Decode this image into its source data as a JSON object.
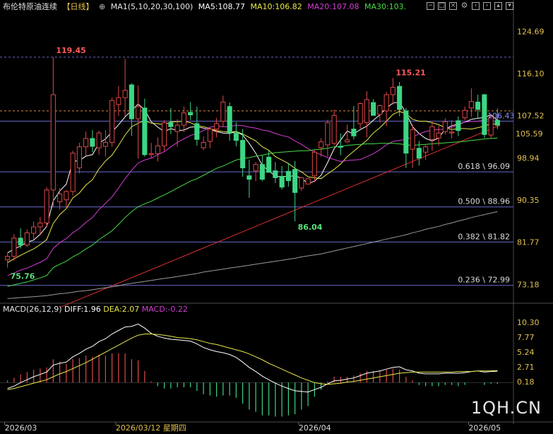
{
  "header": {
    "instrument": "布伦特原油连续",
    "period": "【日线】",
    "ma_params": "MA1(5,10,20,30,100)",
    "ma5": "MA5:108.77",
    "ma10": "MA10:106.82",
    "ma20": "MA20:107.08",
    "ma30": "MA30:103."
  },
  "macd_header": {
    "params": "MACD(26,12,9)",
    "diff": "DIFF:1.96",
    "dea": "DEA:2.07",
    "macd": "MACD:-0.22"
  },
  "watermark": "1QH.CN",
  "colors": {
    "background": "#000000",
    "up_candle": "#e04848",
    "down_candle": "#3cd684",
    "ma5": "#ffffff",
    "ma10": "#e8e84a",
    "ma20": "#d43fd4",
    "ma30": "#44dd44",
    "ma100": "#9a9a9a",
    "trendline": "#e03030",
    "fib_line": "#6a6acd",
    "last_price_line": "#e08a3a",
    "high_line": "#6a6acd",
    "price_label": "#e8c14a"
  },
  "icons": [
    "minimize-icon",
    "expand-icon",
    "close-icon",
    "gear-icon",
    "left-arrow-icon",
    "right-arrow-icon",
    "up-icon",
    "down-icon",
    "compare-icon"
  ],
  "chart_data": {
    "type": "candlestick",
    "title": "布伦特原油连续 【日线】",
    "price_axis": {
      "ticks": [
        124.69,
        116.1,
        107.52,
        98.94,
        90.35,
        81.77,
        73.18
      ],
      "ylim": [
        69.5,
        128.2
      ]
    },
    "macd_axis": {
      "ticks": [
        10.3,
        7.77,
        5.24,
        2.71,
        0.18
      ],
      "ylim": [
        -6.6,
        11.5
      ]
    },
    "x_labels": [
      "2026/03",
      "2026/03/12 星期四",
      "2026/04",
      "2026/05"
    ],
    "annotations": {
      "high_left": "119.45",
      "high_right": "115.21",
      "low_left": "75.76",
      "low_mid": "86.04"
    },
    "price_tags": {
      "current": "106.43",
      "close": "105.59"
    },
    "fibonacci": [
      {
        "label": "0.618 \\ 96.09",
        "value": 96.09
      },
      {
        "label": "0.500 \\ 88.96",
        "value": 88.96
      },
      {
        "label": "0.382 \\ 81.82",
        "value": 81.82
      },
      {
        "label": "0.236 \\ 72.99",
        "value": 72.99
      }
    ],
    "reference_lines": {
      "upper": 119.45,
      "last": 108.5,
      "mid": 106.43
    },
    "candles": [
      [
        78.2,
        79.5,
        76.6,
        78.9
      ],
      [
        78.9,
        83.4,
        78.0,
        82.6
      ],
      [
        82.6,
        84.6,
        80.5,
        81.2
      ],
      [
        81.2,
        84.4,
        80.8,
        83.7
      ],
      [
        83.6,
        86.0,
        82.4,
        84.9
      ],
      [
        84.9,
        86.9,
        83.1,
        85.7
      ],
      [
        85.7,
        93.0,
        85.0,
        92.4
      ],
      [
        92.4,
        119.45,
        88.9,
        111.8
      ],
      [
        90.0,
        92.8,
        88.4,
        91.6
      ],
      [
        90.4,
        92.4,
        88.8,
        92.1
      ],
      [
        92.1,
        100.4,
        91.3,
        99.9
      ],
      [
        96.9,
        102.0,
        95.8,
        101.2
      ],
      [
        101.2,
        104.3,
        99.3,
        102.9
      ],
      [
        102.9,
        104.6,
        100.1,
        101.3
      ],
      [
        101.0,
        104.5,
        99.6,
        104.0
      ],
      [
        101.3,
        104.6,
        99.2,
        102.1
      ],
      [
        102.1,
        111.2,
        101.2,
        110.6
      ],
      [
        109.8,
        113.6,
        107.5,
        111.2
      ],
      [
        111.2,
        119.1,
        107.4,
        112.7
      ],
      [
        113.8,
        114.1,
        103.4,
        106.9
      ],
      [
        106.9,
        113.7,
        98.8,
        109.4
      ],
      [
        109.1,
        111.0,
        99.2,
        99.6
      ],
      [
        99.6,
        102.0,
        98.8,
        99.8
      ],
      [
        99.8,
        103.1,
        98.2,
        101.4
      ],
      [
        101.4,
        106.6,
        100.3,
        106.1
      ],
      [
        106.1,
        109.1,
        103.8,
        105.3
      ],
      [
        104.3,
        106.8,
        101.2,
        105.6
      ],
      [
        105.6,
        109.4,
        104.2,
        108.1
      ],
      [
        108.2,
        110.3,
        106.7,
        107.7
      ],
      [
        105.9,
        109.4,
        101.4,
        102.7
      ],
      [
        101.0,
        103.3,
        100.5,
        102.1
      ],
      [
        102.3,
        105.0,
        100.9,
        104.8
      ],
      [
        104.8,
        107.1,
        103.1,
        105.9
      ],
      [
        106.4,
        111.6,
        105.2,
        110.3
      ],
      [
        109.4,
        110.2,
        102.4,
        104.0
      ],
      [
        104.0,
        106.2,
        101.3,
        102.5
      ],
      [
        102.5,
        104.8,
        95.1,
        96.9
      ],
      [
        95.3,
        98.6,
        90.8,
        94.6
      ],
      [
        96.3,
        98.1,
        94.2,
        97.6
      ],
      [
        97.6,
        99.5,
        94.2,
        94.6
      ],
      [
        99.1,
        100.5,
        98.0,
        96.0
      ],
      [
        96.3,
        98.1,
        93.8,
        94.9
      ],
      [
        95.2,
        97.3,
        92.5,
        93.0
      ],
      [
        96.2,
        97.9,
        93.1,
        94.3
      ],
      [
        96.6,
        98.3,
        86.04,
        91.9
      ],
      [
        92.8,
        95.0,
        92.2,
        94.9
      ],
      [
        93.6,
        94.8,
        93.6,
        94.7
      ],
      [
        95.3,
        100.6,
        94.0,
        100.1
      ],
      [
        101.0,
        102.9,
        99.2,
        102.2
      ],
      [
        101.6,
        106.7,
        99.2,
        106.1
      ],
      [
        101.9,
        108.8,
        101.5,
        107.6
      ],
      [
        101.3,
        103.9,
        99.5,
        101.1
      ],
      [
        102.2,
        105.7,
        102.0,
        102.6
      ],
      [
        104.8,
        109.5,
        102.7,
        103.4
      ],
      [
        105.9,
        110.2,
        104.9,
        110.0
      ],
      [
        106.1,
        112.5,
        103.1,
        110.8
      ],
      [
        110.2,
        110.9,
        108.1,
        107.6
      ],
      [
        107.8,
        109.8,
        106.1,
        109.6
      ],
      [
        108.5,
        112.4,
        105.4,
        111.8
      ],
      [
        111.8,
        115.21,
        109.8,
        113.3
      ],
      [
        113.5,
        114.4,
        107.4,
        108.8
      ],
      [
        108.5,
        109.1,
        96.9,
        99.9
      ],
      [
        100.7,
        105.7,
        96.9,
        104.7
      ],
      [
        100.9,
        102.4,
        97.4,
        98.9
      ],
      [
        100.1,
        101.7,
        98.5,
        101.2
      ],
      [
        102.7,
        106.4,
        100.4,
        105.3
      ],
      [
        103.0,
        105.5,
        101.4,
        104.0
      ],
      [
        104.3,
        107.0,
        103.7,
        106.3
      ],
      [
        104.0,
        106.6,
        102.9,
        104.2
      ],
      [
        106.5,
        107.4,
        103.4,
        104.5
      ],
      [
        107.1,
        109.4,
        106.6,
        108.6
      ],
      [
        109.1,
        113.1,
        107.3,
        110.4
      ],
      [
        110.3,
        111.8,
        107.0,
        108.8
      ],
      [
        111.8,
        112.0,
        103.0,
        103.7
      ],
      [
        103.6,
        107.6,
        103.0,
        107.3
      ],
      [
        106.6,
        109.0,
        104.8,
        105.6
      ]
    ],
    "series": [
      {
        "name": "MA5",
        "values": [
          79.6,
          80.4,
          81.0,
          81.8,
          82.2,
          83.4,
          85.0,
          90.2,
          92.2,
          93.6,
          98.2,
          98.4,
          99.3,
          99.6,
          101.9,
          102.8,
          104.2,
          105.7,
          107.3,
          108.6,
          109.9,
          108.7,
          106.3,
          105.2,
          104.3,
          104.9,
          104.5,
          104.6,
          105.2,
          105.3,
          105.0,
          104.7,
          104.3,
          104.0,
          103.9,
          104.3,
          103.6,
          101.9,
          99.9,
          97.4,
          96.3,
          95.2,
          95.1,
          95.2,
          95.3,
          94.8,
          93.7,
          94.2,
          95.4,
          98.0,
          100.8,
          102.6,
          104.4,
          103.8,
          104.7,
          105.4,
          106.6,
          107.7,
          109.1,
          110.1,
          110.3,
          108.1,
          105.3,
          103.9,
          102.9,
          102.4,
          103.0,
          104.8,
          105.5,
          105.8,
          106.2,
          106.8,
          107.0,
          107.2,
          107.7,
          106.6
        ]
      },
      {
        "name": "MA10",
        "values": [
          77.6,
          78.4,
          79.1,
          79.8,
          80.4,
          81.3,
          82.3,
          85.6,
          87.4,
          88.6,
          90.8,
          91.8,
          93.4,
          94.5,
          96.7,
          98.3,
          99.5,
          101.5,
          103.6,
          105.3,
          106.0,
          106.5,
          106.0,
          105.9,
          105.7,
          106.3,
          106.3,
          106.4,
          106.1,
          105.5,
          105.3,
          104.9,
          104.5,
          104.3,
          104.2,
          104.3,
          103.8,
          103.1,
          102.4,
          101.2,
          100.5,
          99.2,
          98.5,
          97.8,
          96.8,
          96.1,
          95.1,
          94.9,
          94.7,
          95.7,
          96.6,
          97.7,
          99.2,
          100.3,
          101.4,
          102.5,
          104.0,
          105.1,
          106.4,
          107.8,
          108.4,
          107.9,
          106.8,
          106.4,
          106.4,
          106.1,
          105.7,
          105.1,
          104.7,
          104.9,
          104.9,
          104.8,
          105.1,
          105.4,
          105.9,
          105.8
        ]
      },
      {
        "name": "MA20",
        "values": [
          75.0,
          75.5,
          76.1,
          76.5,
          77.1,
          77.7,
          78.4,
          80.5,
          81.7,
          82.5,
          83.7,
          84.6,
          85.8,
          86.8,
          88.4,
          89.7,
          91.0,
          92.8,
          94.7,
          96.4,
          97.9,
          98.5,
          98.9,
          99.6,
          100.2,
          101.2,
          102.1,
          102.8,
          103.5,
          103.9,
          104.5,
          105.2,
          105.4,
          105.3,
          105.3,
          105.6,
          105.5,
          105.2,
          105.0,
          104.6,
          104.4,
          103.9,
          103.5,
          103.2,
          102.4,
          101.7,
          100.8,
          100.1,
          99.6,
          99.0,
          98.6,
          98.2,
          98.4,
          98.5,
          98.6,
          99.2,
          99.8,
          100.6,
          101.6,
          102.3,
          102.5,
          102.7,
          103.2,
          103.8,
          104.3,
          104.6,
          104.7,
          104.8,
          105.2,
          105.7,
          106.2,
          106.4,
          106.4,
          106.6,
          107.0,
          107.1
        ]
      },
      {
        "name": "MA30",
        "values": [
          72.8,
          73.1,
          73.4,
          73.7,
          74.1,
          74.5,
          75.0,
          76.6,
          77.3,
          77.9,
          78.8,
          79.5,
          80.4,
          81.2,
          82.3,
          83.2,
          84.1,
          85.4,
          86.8,
          88.0,
          89.0,
          89.6,
          90.1,
          90.8,
          91.4,
          92.1,
          92.8,
          93.5,
          94.2,
          94.7,
          95.4,
          96.1,
          96.8,
          97.3,
          97.9,
          98.5,
          98.8,
          99.0,
          99.3,
          99.5,
          99.8,
          100.0,
          100.1,
          100.2,
          100.3,
          100.4,
          100.4,
          100.6,
          100.7,
          100.9,
          101.2,
          101.3,
          101.5,
          101.6,
          101.7,
          101.8,
          101.8,
          101.9,
          101.9,
          101.9,
          101.8,
          101.6,
          101.5,
          101.6,
          101.7,
          101.8,
          101.9,
          102.0,
          102.1,
          102.2,
          102.3,
          102.5,
          102.6,
          102.8,
          102.9,
          103.0
        ]
      },
      {
        "name": "MA100",
        "values": [
          70.3,
          70.4,
          70.5,
          70.6,
          70.7,
          70.8,
          70.9,
          71.1,
          71.3,
          71.4,
          71.6,
          71.8,
          71.9,
          72.1,
          72.3,
          72.5,
          72.7,
          72.9,
          73.2,
          73.4,
          73.6,
          73.8,
          74.0,
          74.2,
          74.4,
          74.6,
          74.8,
          75.0,
          75.2,
          75.4,
          75.7,
          75.9,
          76.1,
          76.3,
          76.5,
          76.7,
          76.9,
          77.1,
          77.3,
          77.5,
          77.7,
          77.9,
          78.1,
          78.3,
          78.5,
          78.8,
          79.0,
          79.2,
          79.4,
          79.7,
          80.0,
          80.3,
          80.6,
          80.9,
          81.2,
          81.5,
          81.8,
          82.1,
          82.4,
          82.7,
          83.0,
          83.3,
          83.7,
          84.0,
          84.4,
          84.7,
          85.0,
          85.4,
          85.7,
          86.1,
          86.4,
          86.8,
          87.1,
          87.4,
          87.7,
          88.0
        ]
      }
    ],
    "macd_series": {
      "diff": [
        -1.0,
        -0.6,
        0.0,
        0.5,
        1.0,
        1.4,
        1.8,
        3.0,
        3.3,
        3.5,
        4.4,
        5.0,
        5.7,
        6.2,
        7.0,
        7.5,
        8.3,
        8.9,
        9.5,
        9.6,
        10.0,
        9.3,
        8.4,
        7.9,
        7.6,
        7.4,
        7.3,
        7.2,
        7.1,
        6.6,
        6.0,
        5.6,
        5.3,
        5.1,
        4.8,
        4.3,
        3.5,
        2.6,
        1.9,
        1.1,
        0.5,
        -0.1,
        -0.6,
        -1.0,
        -1.4,
        -1.5,
        -1.6,
        -1.2,
        -0.8,
        -0.2,
        0.3,
        0.4,
        0.6,
        0.8,
        1.2,
        1.6,
        1.8,
        2.0,
        2.3,
        2.6,
        2.7,
        2.2,
        2.0,
        1.6,
        1.5,
        1.5,
        1.5,
        1.6,
        1.6,
        1.6,
        1.7,
        1.9,
        2.0,
        1.8,
        1.9,
        1.96
      ],
      "dea": [
        -1.2,
        -1.0,
        -0.7,
        -0.4,
        -0.1,
        0.2,
        0.5,
        1.0,
        1.5,
        1.9,
        2.4,
        2.9,
        3.4,
        4.0,
        4.6,
        5.2,
        5.8,
        6.4,
        7.0,
        7.6,
        8.1,
        8.3,
        8.3,
        8.2,
        8.1,
        7.9,
        7.7,
        7.6,
        7.5,
        7.3,
        7.0,
        6.7,
        6.5,
        6.2,
        5.9,
        5.6,
        5.3,
        4.9,
        4.4,
        3.9,
        3.3,
        2.8,
        2.3,
        1.8,
        1.3,
        0.8,
        0.4,
        0.0,
        -0.2,
        -0.3,
        -0.2,
        -0.1,
        0.1,
        0.2,
        0.4,
        0.6,
        0.8,
        1.0,
        1.2,
        1.4,
        1.6,
        1.7,
        1.8,
        1.8,
        1.8,
        1.8,
        1.8,
        1.8,
        1.8,
        1.9,
        1.9,
        1.9,
        2.0,
        2.0,
        2.0,
        2.07
      ],
      "macd": [
        0.4,
        0.8,
        1.4,
        1.8,
        2.2,
        2.4,
        2.6,
        4.0,
        3.6,
        3.2,
        4.0,
        4.2,
        4.6,
        4.4,
        4.8,
        4.6,
        5.0,
        5.0,
        5.0,
        4.0,
        3.8,
        2.0,
        0.2,
        -0.6,
        -1.0,
        -1.0,
        -0.8,
        -0.8,
        -0.8,
        -1.4,
        -2.0,
        -2.2,
        -2.4,
        -2.2,
        -2.2,
        -2.6,
        -3.6,
        -4.6,
        -5.0,
        -5.6,
        -5.6,
        -5.8,
        -5.8,
        -5.6,
        -5.4,
        -4.6,
        -4.0,
        -2.4,
        -1.2,
        0.2,
        1.0,
        1.0,
        1.0,
        1.2,
        1.6,
        2.0,
        2.0,
        2.0,
        2.2,
        2.4,
        2.2,
        1.0,
        0.4,
        -0.4,
        -0.6,
        -0.6,
        -0.6,
        -0.4,
        -0.4,
        -0.6,
        -0.4,
        0.0,
        0.0,
        -0.4,
        -0.2,
        -0.22
      ]
    }
  }
}
